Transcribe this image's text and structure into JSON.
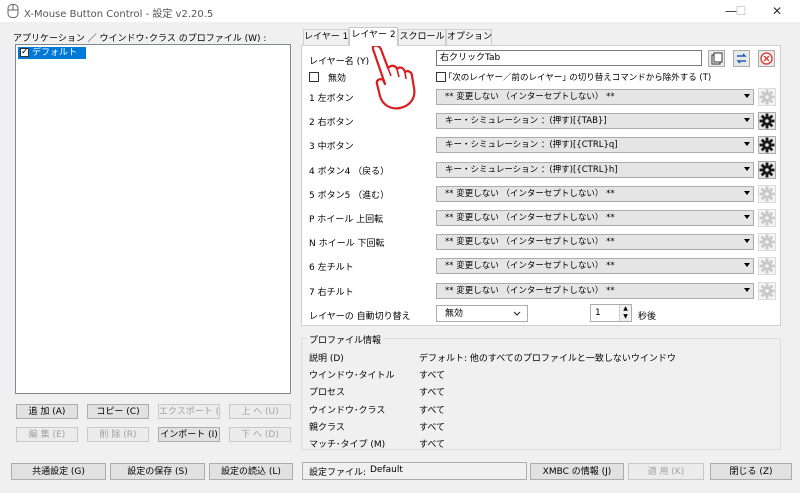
{
  "window": {
    "title": "X-Mouse Button Control - 設定    v2.20.5",
    "controls": [
      "—",
      "☐",
      "✕"
    ]
  },
  "profiles": {
    "label": "アプリケーション ／ ウインドウ･クラス のプロファイル (W) :",
    "items": [
      {
        "name": "デフォルト",
        "checked": true
      }
    ],
    "buttons": {
      "add": "追 加  (A)",
      "copy": "コピー  (C)",
      "export": "エクスポート (X)",
      "up": "上 へ  (U)",
      "edit": "編 集  (E)",
      "delete": "削 除  (R)",
      "import": "インポート  (I)",
      "down": "下 へ  (D)"
    }
  },
  "tabs": [
    "レイヤー 1",
    "レイヤー 2",
    "スクロール",
    "オプション"
  ],
  "layer": {
    "name_label": "レイヤー名 (Y)",
    "name_value": "右クリックTab",
    "disable_label": "無効",
    "exclude_label": "｢次のレイヤー／前のレイヤー｣ の切り替えコマンドから除外する  (T)",
    "rows": [
      {
        "label": "1  左ボタン",
        "value": "** 変更しない （インターセプトしない） **",
        "gear_enabled": false
      },
      {
        "label": "2  右ボタン",
        "value": "キー・シミュレーション ：(押す)[{TAB}]",
        "gear_enabled": true
      },
      {
        "label": "3  中ボタン",
        "value": "キー・シミュレーション ：(押す)[{CTRL}q]",
        "gear_enabled": true
      },
      {
        "label": "4  ボタン4 （戻る）",
        "value": "キー・シミュレーション ：(押す)[{CTRL}h]",
        "gear_enabled": true
      },
      {
        "label": "5  ボタン5 （進む）",
        "value": "** 変更しない （インターセプトしない） **",
        "gear_enabled": false
      },
      {
        "label": "P  ホイール 上回転",
        "value": "** 変更しない （インターセプトしない） **",
        "gear_enabled": false
      },
      {
        "label": "N  ホイール 下回転",
        "value": "** 変更しない （インターセプトしない） **",
        "gear_enabled": false
      },
      {
        "label": "6  左チルト",
        "value": "** 変更しない （インターセプトしない） **",
        "gear_enabled": false
      },
      {
        "label": "7  右チルト",
        "value": "** 変更しない （インターセプトしない） **",
        "gear_enabled": false
      }
    ],
    "auto_switch_label": "レイヤーの 自動切り替え",
    "auto_switch_value": "無効",
    "seconds_value": "1",
    "seconds_unit": "秒後"
  },
  "profile_info": {
    "title": "プロファイル情報",
    "rows": [
      {
        "key": "説明 (D)",
        "value": "デフォルト: 他のすべてのプロファイルと一致しないウインドウ"
      },
      {
        "key": "ウインドウ･タイトル",
        "value": "すべて"
      },
      {
        "key": "プロセス",
        "value": "すべて"
      },
      {
        "key": "ウインドウ･クラス",
        "value": "すべて"
      },
      {
        "key": "親クラス",
        "value": "すべて"
      },
      {
        "key": "マッチ･タイプ (M)",
        "value": "すべて"
      }
    ]
  },
  "footer": {
    "common_settings": "共通設定  (G)",
    "save_settings": "設定の保存  (S)",
    "load_settings": "設定の読込  (L)",
    "config_file_label": "設定ファイル:",
    "config_file_value": "Default",
    "xmbc_info": "XMBC の情報  (J)",
    "apply": "適 用  (K)",
    "close": "閉じる  (Z)"
  },
  "colors": {
    "accent": "#0078d7",
    "delete_red": "#e0362c",
    "hand_red": "#d81e1e"
  }
}
